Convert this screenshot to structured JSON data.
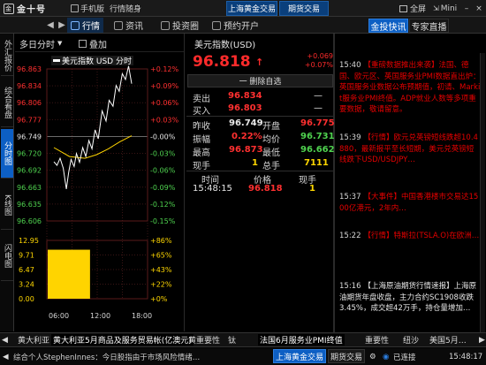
{
  "titlebar": {
    "app_name": "金十号",
    "links": [
      "手机版",
      "行情随身"
    ],
    "market_tabs": [
      "上海黄金交易",
      "期货交易"
    ],
    "window": [
      "全屏",
      "Mini"
    ]
  },
  "nav": {
    "items": [
      "行情",
      "资讯",
      "投资圈",
      "预约开户"
    ],
    "active_index": 0,
    "right_tabs": [
      "金投快讯",
      "专家直播"
    ],
    "right_active": 0
  },
  "vtabs": {
    "items": [
      "外汇报价",
      "综合看盘",
      "分时图",
      "K线图",
      "闪电图"
    ],
    "active_index": 2
  },
  "chart_head": {
    "period": "多日分时",
    "overlay": "叠加"
  },
  "chart_data": {
    "type": "line",
    "legend": "美元指数 USD 分时",
    "time_labels": [
      "06:00",
      "12:00",
      "18:00"
    ],
    "price_labels": [
      "96.863",
      "96.834",
      "96.806",
      "96.777",
      "96.749",
      "96.720",
      "96.692",
      "96.663",
      "96.635",
      "96.606"
    ],
    "pct_labels": [
      "+0.12%",
      "+0.09%",
      "+0.06%",
      "+0.03%",
      "-0.00%",
      "-0.03%",
      "-0.06%",
      "-0.09%",
      "-0.12%",
      "-0.15%"
    ],
    "price_ylim": [
      96.606,
      96.863
    ],
    "prev_close": 96.749,
    "price_series": [
      {
        "t": 0.0,
        "p": 96.706
      },
      {
        "t": 0.04,
        "p": 96.7
      },
      {
        "t": 0.08,
        "p": 96.712
      },
      {
        "t": 0.12,
        "p": 96.695
      },
      {
        "t": 0.16,
        "p": 96.66
      },
      {
        "t": 0.19,
        "p": 96.688
      },
      {
        "t": 0.22,
        "p": 96.71
      },
      {
        "t": 0.26,
        "p": 96.698
      },
      {
        "t": 0.29,
        "p": 96.72
      },
      {
        "t": 0.33,
        "p": 96.705
      },
      {
        "t": 0.37,
        "p": 96.73
      },
      {
        "t": 0.41,
        "p": 96.715
      },
      {
        "t": 0.45,
        "p": 96.742
      },
      {
        "t": 0.49,
        "p": 96.728
      },
      {
        "t": 0.53,
        "p": 96.76
      },
      {
        "t": 0.57,
        "p": 96.745
      },
      {
        "t": 0.62,
        "p": 96.792
      },
      {
        "t": 0.67,
        "p": 96.775
      },
      {
        "t": 0.71,
        "p": 96.81
      },
      {
        "t": 0.76,
        "p": 96.8
      },
      {
        "t": 0.8,
        "p": 96.835
      },
      {
        "t": 0.84,
        "p": 96.825
      },
      {
        "t": 0.88,
        "p": 96.855
      },
      {
        "t": 0.92,
        "p": 96.845
      },
      {
        "t": 0.96,
        "p": 96.868
      },
      {
        "t": 1.0,
        "p": 96.838
      }
    ],
    "avg_series": [
      {
        "t": 0.0,
        "p": 96.73
      },
      {
        "t": 0.2,
        "p": 96.715
      },
      {
        "t": 0.4,
        "p": 96.712
      },
      {
        "t": 0.55,
        "p": 96.718
      },
      {
        "t": 0.7,
        "p": 96.728
      },
      {
        "t": 0.85,
        "p": 96.74
      },
      {
        "t": 1.0,
        "p": 96.75
      }
    ],
    "volume_labels": [
      "12.95",
      "9.71",
      "6.47",
      "3.24",
      "0.00"
    ],
    "volume_pct_labels": [
      "+86%",
      "+65%",
      "+43%",
      "+22%",
      "+0%"
    ],
    "volume_ylim": [
      0,
      12.95
    ],
    "volume_fill_pct": 0.84
  },
  "quote": {
    "name": "美元指数(USD)",
    "price": "96.818",
    "change": "+0.069",
    "change_pct": "+0.07%",
    "watch_label": "一 删除自选",
    "sell_label": "卖出",
    "sell_value": "96.834",
    "sell_dash": "—",
    "buy_label": "买入",
    "buy_value": "96.803",
    "buy_dash": "—",
    "stats": [
      {
        "l1": "昨收",
        "v1": "96.749",
        "l2": "开盘",
        "v2": "96.775"
      },
      {
        "l1": "振幅",
        "v1": "0.22%",
        "l2": "均价",
        "v2": "96.731"
      },
      {
        "l1": "最高",
        "v1": "96.873",
        "l2": "最低",
        "v2": "96.662"
      },
      {
        "l1": "现手",
        "v1": "1",
        "l2": "总手",
        "v2": "7111"
      }
    ],
    "trade_headers": [
      "时间",
      "价格",
      "现手"
    ],
    "trades": [
      {
        "time": "15:48:15",
        "price": "96.818",
        "qty": "1"
      }
    ]
  },
  "news": [
    {
      "time": "15:40",
      "text": "【重磅数据推出来袭】法国、德国、欧元区、英国服务业PMI数据直出炉：英国服务业数据公布预期值，初请、Markit服务业PMI终值。ADP就业人数等多项重要数据，敬请留意。",
      "color": "red"
    },
    {
      "time": "15:39",
      "text": "【行情】欧元兑英镑短线跌超10.4880，最新报平至长短期，美元兑英镑短线跌下USD/USDJPY…",
      "color": "red"
    },
    {
      "time": "15:37",
      "text": "【大事件】中国香港楼市交易达1500亿港元，2年内…",
      "color": "red"
    },
    {
      "time": "15:22",
      "text": "【行情】特斯拉(TSLA.O)在欧洲…",
      "color": "red"
    },
    {
      "time": "15:16",
      "text": "【上海原油期货行情速报】上海原油期货年盘收盘，主力合约SC1908收跌3.45%，成交超42万手，持仓量增加…",
      "color": "white"
    }
  ],
  "bottom_tabs": [
    "黄大利亚",
    "黄大利亚5月商品及服务贸易帐(亿澳元)",
    "黄重要性",
    "钛",
    "法国6月服务业PMI终值",
    "重要性",
    "纽沙",
    "美国5月…"
  ],
  "status": {
    "ticker": "综合个人StephenInnes：今日股指由于市场风险情绪…",
    "buttons": [
      "上海黄金交易",
      "期货交易"
    ],
    "connected": "已连接",
    "clock": "15:48:17"
  }
}
